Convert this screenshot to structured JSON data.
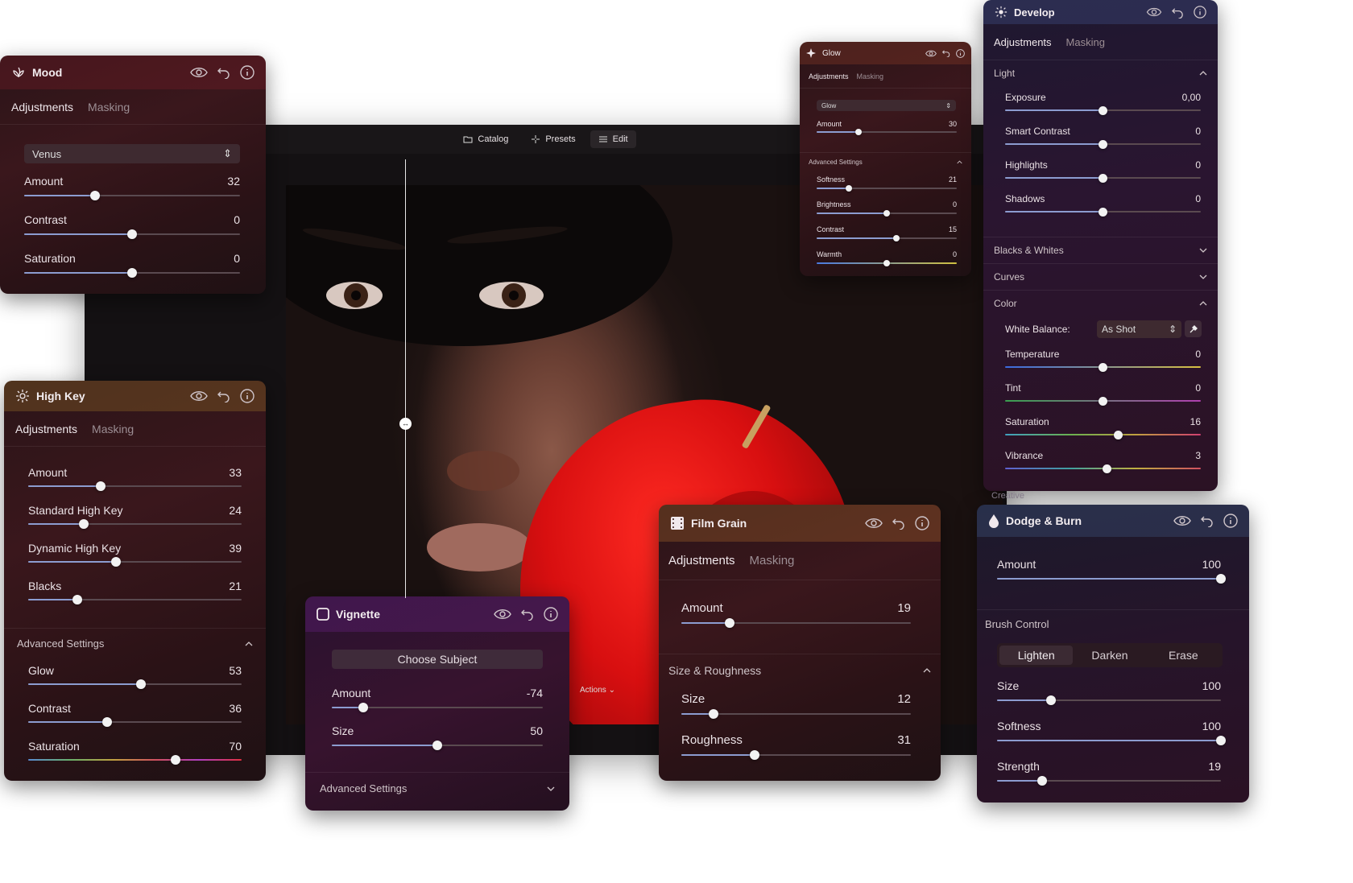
{
  "editor": {
    "toolbar": {
      "catalog": "Catalog",
      "presets": "Presets",
      "edit": "Edit"
    },
    "actions": "Actions ⌄"
  },
  "mood": {
    "title": "Mood",
    "tab_adjust": "Adjustments",
    "tab_mask": "Masking",
    "preset": "Venus",
    "sliders": [
      {
        "label": "Amount",
        "value": "32",
        "pos": 0.33
      },
      {
        "label": "Contrast",
        "value": "0",
        "pos": 0.5
      },
      {
        "label": "Saturation",
        "value": "0",
        "pos": 0.5
      }
    ]
  },
  "highkey": {
    "title": "High Key",
    "tab_adjust": "Adjustments",
    "tab_mask": "Masking",
    "sliders": [
      {
        "label": "Amount",
        "value": "33",
        "pos": 0.34
      },
      {
        "label": "Standard High Key",
        "value": "24",
        "pos": 0.26
      },
      {
        "label": "Dynamic High Key",
        "value": "39",
        "pos": 0.41
      },
      {
        "label": "Blacks",
        "value": "21",
        "pos": 0.23
      }
    ],
    "advanced": "Advanced Settings",
    "adv_sliders": [
      {
        "label": "Glow",
        "value": "53",
        "pos": 0.53
      },
      {
        "label": "Contrast",
        "value": "36",
        "pos": 0.37
      },
      {
        "label": "Saturation",
        "value": "70",
        "pos": 0.69
      }
    ]
  },
  "vignette": {
    "title": "Vignette",
    "choose": "Choose Subject",
    "sliders": [
      {
        "label": "Amount",
        "value": "-74",
        "pos": 0.15
      },
      {
        "label": "Size",
        "value": "50",
        "pos": 0.5
      }
    ],
    "advanced": "Advanced Settings"
  },
  "glow": {
    "title": "Glow",
    "tab_adjust": "Adjustments",
    "tab_mask": "Masking",
    "preset": "Glow",
    "amount": {
      "label": "Amount",
      "value": "30",
      "pos": 0.3
    },
    "advanced": "Advanced Settings",
    "sliders": [
      {
        "label": "Softness",
        "value": "21",
        "pos": 0.23
      },
      {
        "label": "Brightness",
        "value": "0",
        "pos": 0.5
      },
      {
        "label": "Contrast",
        "value": "15",
        "pos": 0.57
      },
      {
        "label": "Warmth",
        "value": "0",
        "pos": 0.5
      }
    ]
  },
  "filmgrain": {
    "title": "Film Grain",
    "tab_adjust": "Adjustments",
    "tab_mask": "Masking",
    "amount": {
      "label": "Amount",
      "value": "19",
      "pos": 0.21
    },
    "section": "Size & Roughness",
    "sliders": [
      {
        "label": "Size",
        "value": "12",
        "pos": 0.14
      },
      {
        "label": "Roughness",
        "value": "31",
        "pos": 0.32
      }
    ]
  },
  "develop": {
    "title": "Develop",
    "tab_adjust": "Adjustments",
    "tab_mask": "Masking",
    "light": "Light",
    "light_sliders": [
      {
        "label": "Exposure",
        "value": "0,00",
        "pos": 0.5
      },
      {
        "label": "Smart Contrast",
        "value": "0",
        "pos": 0.5
      },
      {
        "label": "Highlights",
        "value": "0",
        "pos": 0.5
      },
      {
        "label": "Shadows",
        "value": "0",
        "pos": 0.5
      }
    ],
    "blacks": "Blacks & Whites",
    "curves": "Curves",
    "color": "Color",
    "wb_label": "White Balance:",
    "wb_value": "As Shot",
    "color_sliders": [
      {
        "label": "Temperature",
        "value": "0",
        "pos": 0.5
      },
      {
        "label": "Tint",
        "value": "0",
        "pos": 0.5
      },
      {
        "label": "Saturation",
        "value": "16",
        "pos": 0.58
      },
      {
        "label": "Vibrance",
        "value": "3",
        "pos": 0.52
      }
    ],
    "creative": "Creative"
  },
  "dodge": {
    "title": "Dodge & Burn",
    "amount": {
      "label": "Amount",
      "value": "100",
      "pos": 1.0
    },
    "brush": "Brush Control",
    "modes": [
      "Lighten",
      "Darken",
      "Erase"
    ],
    "sliders": [
      {
        "label": "Size",
        "value": "100",
        "pos": 0.24
      },
      {
        "label": "Softness",
        "value": "100",
        "pos": 1.0
      },
      {
        "label": "Strength",
        "value": "19",
        "pos": 0.2
      }
    ]
  }
}
